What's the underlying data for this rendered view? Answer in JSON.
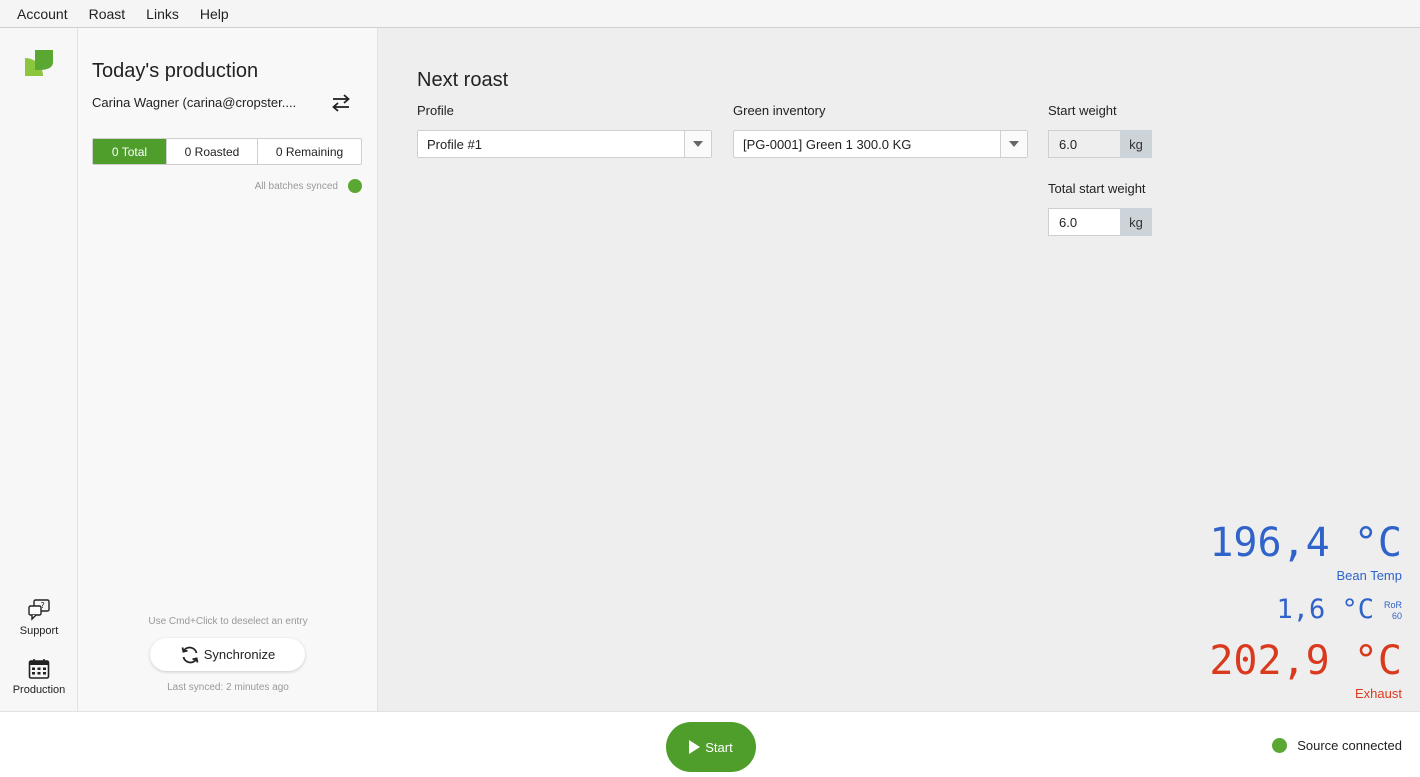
{
  "menu": [
    "Account",
    "Roast",
    "Links",
    "Help"
  ],
  "rail": {
    "support_label": "Support",
    "production_label": "Production"
  },
  "production": {
    "title": "Today's production",
    "user": "Carina Wagner (carina@cropster....",
    "tabs": [
      {
        "label": "0 Total",
        "active": true
      },
      {
        "label": "0 Roasted",
        "active": false
      },
      {
        "label": "0 Remaining",
        "active": false
      }
    ],
    "synced_status": "All batches synced",
    "hint": "Use Cmd+Click to deselect an entry",
    "sync_button": "Synchronize",
    "last_synced": "Last synced: 2 minutes ago"
  },
  "next_roast": {
    "title": "Next roast",
    "profile_label": "Profile",
    "profile_value": "Profile #1",
    "green_label": "Green inventory",
    "green_value": "[PG-0001] Green 1 300.0 KG",
    "start_weight_label": "Start weight",
    "start_weight_value": "6.0",
    "start_weight_unit": "kg",
    "total_weight_label": "Total start weight",
    "total_weight_value": "6.0",
    "total_weight_unit": "kg"
  },
  "readouts": {
    "bean_temp": "196,4 °C",
    "bean_label": "Bean Temp",
    "ror": "1,6 °C",
    "ror_label_top": "RoR",
    "ror_label_bottom": "60",
    "exhaust": "202,9 °C",
    "exhaust_label": "Exhaust"
  },
  "footer": {
    "start_label": "Start",
    "source_status": "Source connected"
  },
  "colors": {
    "accent_green": "#4f9e2c",
    "bean_blue": "#2f63c9",
    "exhaust_red": "#d93a1e"
  }
}
